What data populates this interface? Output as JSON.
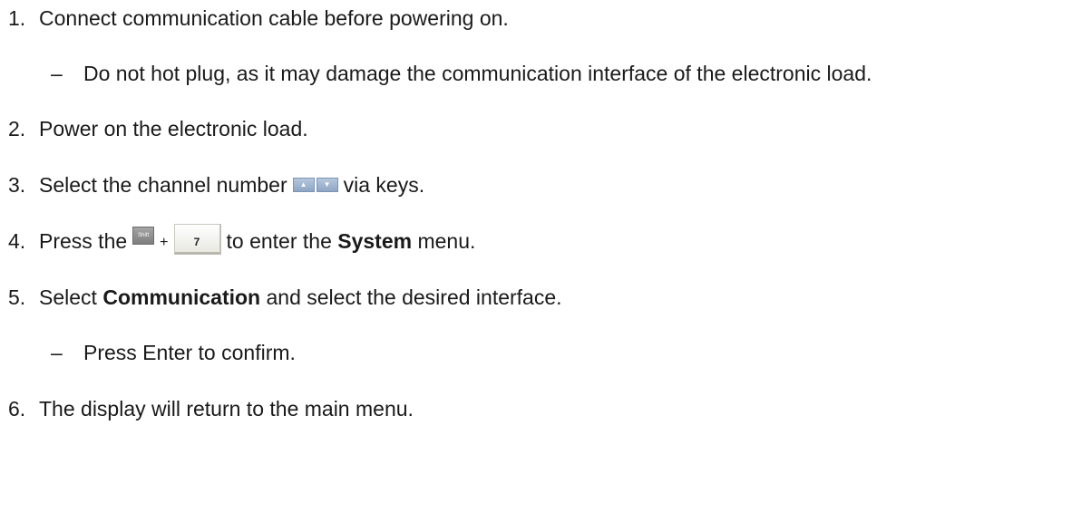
{
  "steps": [
    {
      "number": "1.",
      "text": "Connect communication cable before powering on."
    },
    {
      "number": "2.",
      "text": "Power on the electronic load."
    },
    {
      "number": "3.",
      "text_before": "Select the channel number",
      "text_after": "via keys."
    },
    {
      "number": "4.",
      "text_before": "Press the",
      "plus": "+",
      "text_middle": "to enter the",
      "bold": "System",
      "text_after": "menu."
    },
    {
      "number": "5.",
      "text_before": "Select",
      "bold": "Communication",
      "text_after": "and select the desired interface."
    },
    {
      "number": "6.",
      "text": "The display will return to the main menu."
    }
  ],
  "substeps": [
    {
      "dash": "–",
      "text": "Do not hot plug, as it may damage the communication interface of the electronic load."
    },
    {
      "dash": "–",
      "text": "Press Enter to confirm."
    }
  ],
  "keys": {
    "up_arrow": "▲",
    "down_arrow": "▼",
    "shift_label": "Shift",
    "seven_label": "7"
  },
  "icons": [
    "up-arrow-key-icon",
    "down-arrow-key-icon",
    "shift-key-icon",
    "number-7-key-icon"
  ]
}
